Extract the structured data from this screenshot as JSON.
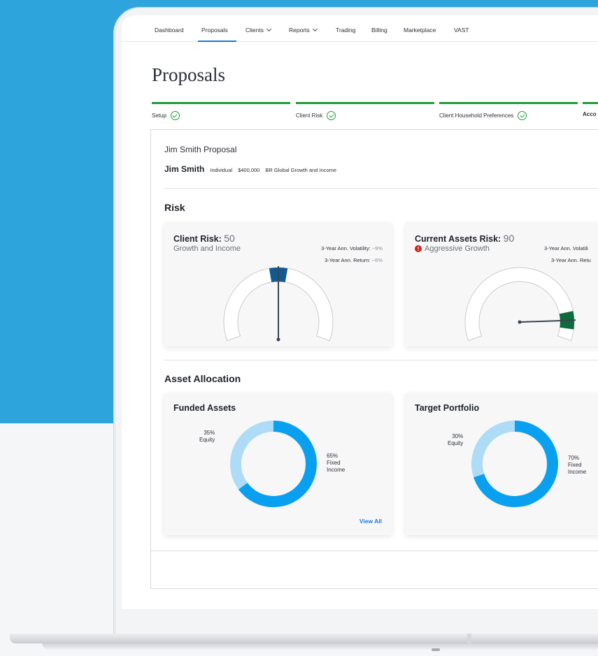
{
  "nav": {
    "items": [
      "Dashboard",
      "Proposals",
      "Clients",
      "Reports",
      "Trading",
      "Billing",
      "Marketplace",
      "VAST"
    ],
    "active": "Proposals"
  },
  "page_title": "Proposals",
  "steps": [
    {
      "label": "Setup",
      "status": "complete"
    },
    {
      "label": "Client Risk",
      "status": "complete"
    },
    {
      "label": "Client Household Preferences",
      "status": "complete"
    },
    {
      "label": "Acco",
      "status": "current"
    }
  ],
  "proposal": {
    "title": "Jim Smith Proposal",
    "client_name": "Jim Smith",
    "account_type": "Individual",
    "amount": "$400,000",
    "model": "BR Global Growth and Income"
  },
  "risk": {
    "section_title": "Risk",
    "client": {
      "title": "Client Risk:",
      "score": "50",
      "category": "Growth and Income",
      "volatility_label": "3-Year Ann. Volatility:",
      "volatility_value": "~9%",
      "return_label": "3-Year Ann. Return:",
      "return_value": "~6%",
      "gauge_level": 50,
      "color": "#0f5a8f"
    },
    "current": {
      "title": "Current Assets Risk:",
      "score": "90",
      "category": "Aggressive Growth",
      "warning_icon": "alert-circle-icon",
      "volatility_label": "3-Year Ann. Volatili",
      "return_label": "3-Year Ann. Retu",
      "gauge_level": 90,
      "color": "#0e6b3d"
    }
  },
  "allocation": {
    "section_title": "Asset Allocation",
    "funded": {
      "title": "Funded Assets",
      "equity_pct": "35%",
      "equity_label": "Equity",
      "fixed_pct": "65%",
      "fixed_label_1": "Fixed",
      "fixed_label_2": "Income",
      "equity_value": 35,
      "fixed_value": 65,
      "view_all": "View All"
    },
    "target": {
      "title": "Target Portfolio",
      "equity_pct": "30%",
      "equity_label": "Equity",
      "fixed_pct": "70%",
      "fixed_label_1": "Fixed",
      "fixed_label_2": "Income",
      "equity_value": 30,
      "fixed_value": 70
    }
  },
  "colors": {
    "equity": "#aedcf7",
    "fixed_income": "#0aa0f0",
    "step_complete": "#1e9b3a",
    "link": "#1a7bd6"
  }
}
